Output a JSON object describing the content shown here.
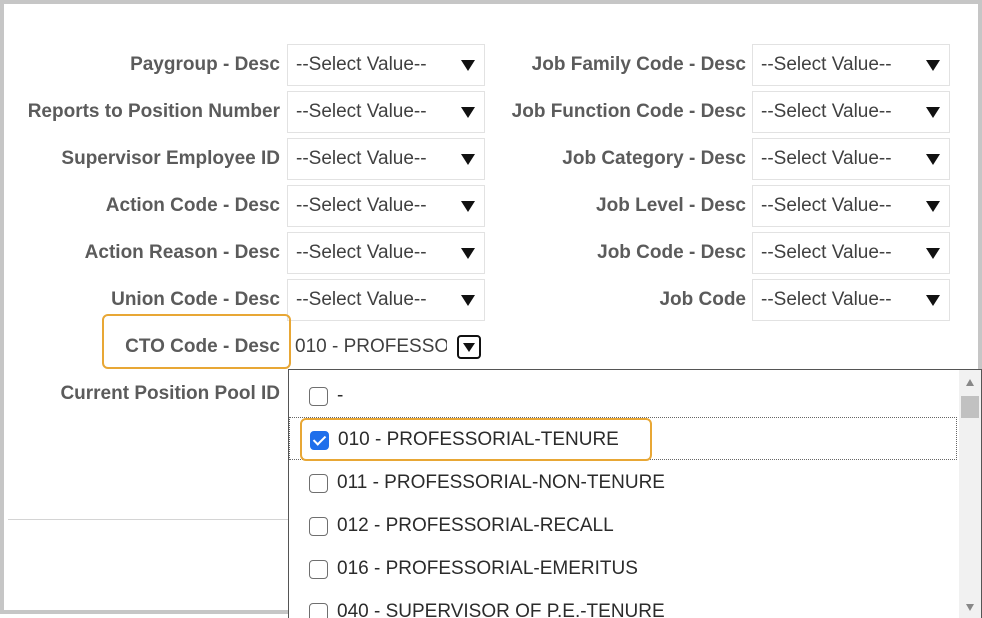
{
  "form": {
    "left_fields": [
      {
        "label": "Paygroup - Desc",
        "value": "--Select Value--"
      },
      {
        "label": "Reports to Position Number",
        "value": "--Select Value--"
      },
      {
        "label": "Supervisor Employee ID",
        "value": "--Select Value--"
      },
      {
        "label": "Action Code - Desc",
        "value": "--Select Value--"
      },
      {
        "label": "Action Reason - Desc",
        "value": "--Select Value--"
      },
      {
        "label": "Union Code - Desc",
        "value": "--Select Value--"
      }
    ],
    "right_fields": [
      {
        "label": "Job Family Code - Desc",
        "value": "--Select Value--"
      },
      {
        "label": "Job Function Code - Desc",
        "value": "--Select Value--"
      },
      {
        "label": "Job Category - Desc",
        "value": "--Select Value--"
      },
      {
        "label": "Job Level - Desc",
        "value": "--Select Value--"
      },
      {
        "label": "Job Code - Desc",
        "value": "--Select Value--"
      },
      {
        "label": "Job Code",
        "value": "--Select Value--"
      }
    ],
    "cto": {
      "label": "CTO Code - Desc",
      "value": "010 - PROFESSO"
    },
    "pool": {
      "label": "Current Position Pool ID"
    }
  },
  "dropdown": {
    "options": [
      {
        "label": "-",
        "checked": false
      },
      {
        "label": "010 - PROFESSORIAL-TENURE",
        "checked": true
      },
      {
        "label": "011 - PROFESSORIAL-NON-TENURE",
        "checked": false
      },
      {
        "label": "012 - PROFESSORIAL-RECALL",
        "checked": false
      },
      {
        "label": "016 - PROFESSORIAL-EMERITUS",
        "checked": false
      },
      {
        "label": "040 - SUPERVISOR OF P.E.-TENURE",
        "checked": false
      }
    ]
  },
  "colors": {
    "highlight": "#e8a735",
    "checkbox_checked": "#1f6feb",
    "label_text": "#5b5b5b"
  },
  "icons": {
    "select_arrow": "triangle-down-icon",
    "checkbox": "checkbox-icon"
  }
}
